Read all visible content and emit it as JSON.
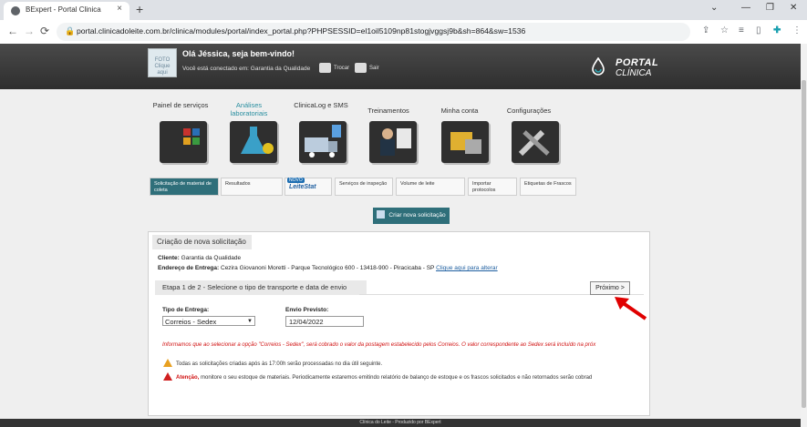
{
  "browser": {
    "tab_title": "BExpert - Portal Clinica",
    "tab_close": "×",
    "new_tab": "+",
    "url": "portal.clinicadoleite.com.br/clinica/modules/portal/index_portal.php?PHPSESSID=el1oil5109np81stogjvggsj9b&sh=864&sw=1536",
    "window_controls": [
      "⌄",
      "—",
      "❐",
      "✕"
    ],
    "nav_icons": [
      "←",
      "→",
      "⟳"
    ],
    "toolbar_icons": [
      "share-icon",
      "star-icon",
      "reading-list-icon",
      "sidebar-icon",
      "extension-icon",
      "menu-icon"
    ]
  },
  "header": {
    "photo_label": "FOTO Clique aqui",
    "greeting": "Olá Jéssica, seja bem-vindo!",
    "connected_text": "Você está conectado em: Garantia da Qualidade",
    "trocar": "Trocar",
    "sair": "Sair",
    "logo_line1": "PORTAL",
    "logo_line2": "CLÍNICA"
  },
  "main_menu": [
    {
      "label": "Painel de serviços",
      "icon": "dashboard-icon"
    },
    {
      "label": "Análises laboratoriais",
      "icon": "lab-flask-icon",
      "active": true
    },
    {
      "label": "ClinicaLog e SMS",
      "icon": "truck-sms-icon"
    },
    {
      "label": "Treinamentos",
      "icon": "training-icon"
    },
    {
      "label": "Minha conta",
      "icon": "account-icon"
    },
    {
      "label": "Configurações",
      "icon": "tools-icon"
    }
  ],
  "sub_menu": [
    {
      "label": "Solicitação de material de coleta",
      "active": true
    },
    {
      "label": "Resultados"
    },
    {
      "label": "LeiteStat",
      "badge": "NOVO"
    },
    {
      "label": "Serviços de inspeção"
    },
    {
      "label": "Volume de leite"
    },
    {
      "label": "Importar protocolos"
    },
    {
      "label": "Etiquetas de Frascos"
    }
  ],
  "create_button": "Criar nova solicitação",
  "form": {
    "title": "Criação de nova solicitação",
    "cliente_label": "Cliente:",
    "cliente_value": "Garantia da Qualidade",
    "endereco_label": "Endereço de Entrega:",
    "endereco_value": "Cezira Giovanoni Moretti - Parque Tecnológico  600 - 13418-900 - Piracicaba - SP",
    "endereco_link": "Clique aqui para alterar",
    "step_title": "Etapa 1 de 2 - Selecione o tipo de transporte e data de envio",
    "next_button": "Próximo >",
    "tipo_label": "Tipo de Entrega:",
    "tipo_value": "Correios - Sedex",
    "envio_label": "Envio Previsto:",
    "envio_value": "12/04/2022",
    "warning_red": "Informamos que ao selecionar a opção \"Correios - Sedex\", será cobrado o valor da postagem estabelecido pelos Correios. O valor correspondente ao Sedex será incluído na próx",
    "note1": "Todas as solicitações criadas após às 17:00h serão processadas no dia útil seguinte.",
    "note2_bold": "Atenção,",
    "note2": " monitore o seu estoque de materiais. Periodicamente estaremos emitindo relatório de balanço de estoque e os frascos solicitados e não retornados serão cobrad"
  },
  "footer": "Clínica do Leite - Produzido por BExpert",
  "colors": {
    "accent": "#2f6f7a",
    "header": "#3a3a3a",
    "warning": "#d01010",
    "arrow": "#e00000"
  }
}
